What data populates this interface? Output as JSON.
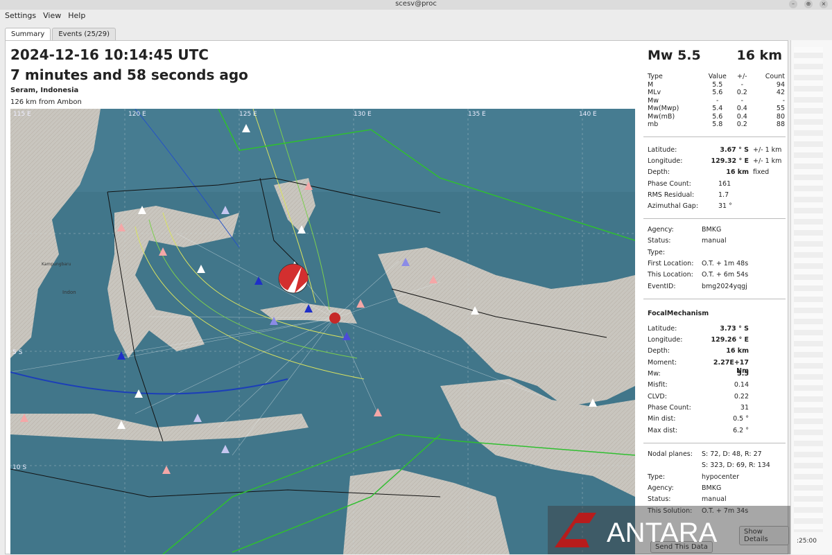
{
  "window": {
    "title": "scesv@proc",
    "buttons": [
      "–",
      "⊕",
      "×"
    ]
  },
  "menu": {
    "items": [
      "Settings",
      "View",
      "Help"
    ]
  },
  "tabs": [
    {
      "label": "Summary"
    },
    {
      "label": "Events (25/29)"
    }
  ],
  "event": {
    "time": "2024-12-16 10:14:45 UTC",
    "ago": "7 minutes and 58 seconds ago",
    "region": "Seram, Indonesia",
    "distance": "126 km from Ambon"
  },
  "summary": {
    "magnitude": "Mw 5.5",
    "depth": "16 km",
    "mag_headers": [
      "Type",
      "Value",
      "+/-",
      "Count"
    ],
    "mag_rows": [
      [
        "M",
        "5.5",
        "-",
        "94"
      ],
      [
        "MLv",
        "5.6",
        "0.2",
        "42"
      ],
      [
        "Mw",
        "-",
        "-",
        "-"
      ],
      [
        "Mw(Mwp)",
        "5.4",
        "0.4",
        "55"
      ],
      [
        "Mw(mB)",
        "5.6",
        "0.4",
        "80"
      ],
      [
        "mb",
        "5.8",
        "0.2",
        "88"
      ]
    ],
    "origin": {
      "latitude_label": "Latitude:",
      "latitude": "3.67 ° S",
      "latitude_unc": "+/-  1 km",
      "longitude_label": "Longitude:",
      "longitude": "129.32 ° E",
      "longitude_unc": "+/-  1 km",
      "depth_label": "Depth:",
      "depth": "16 km",
      "depth_note": "fixed",
      "phase_label": "Phase Count:",
      "phase": "161",
      "rms_label": "RMS Residual:",
      "rms": "1.7",
      "gap_label": "Azimuthal Gap:",
      "gap": "31 °"
    },
    "agency": {
      "agency_label": "Agency:",
      "agency": "BMKG",
      "status_label": "Status:",
      "status": "manual",
      "type_label": "Type:",
      "type": "",
      "first_label": "First Location:",
      "first": "O.T. + 1m 48s",
      "this_label": "This Location:",
      "this": "O.T. + 6m 54s",
      "eventid_label": "EventID:",
      "eventid": "bmg2024yqgj"
    },
    "focal": {
      "title": "FocalMechanism",
      "latitude_label": "Latitude:",
      "latitude": "3.73 ° S",
      "longitude_label": "Longitude:",
      "longitude": "129.26 ° E",
      "depth_label": "Depth:",
      "depth": "16 km",
      "moment_label": "Moment:",
      "moment": "2.27E+17 Nm",
      "mw_label": "Mw:",
      "mw": "5.5",
      "misfit_label": "Misfit:",
      "misfit": "0.14",
      "clvd_label": "CLVD:",
      "clvd": "0.22",
      "phase_label": "Phase Count:",
      "phase": "31",
      "mindist_label": "Min dist:",
      "mindist": "0.5 °",
      "maxdist_label": "Max dist:",
      "maxdist": "6.2 °",
      "nodal_label": "Nodal planes:",
      "nodal1": "S: 72, D: 48, R: 27",
      "nodal2": "S: 323, D: 69, R: 134",
      "type_label": "Type:",
      "type": "hypocenter",
      "agency_label": "Agency:",
      "agency": "BMKG",
      "status_label": "Status:",
      "status": "manual",
      "solution_label": "This Solution:",
      "solution": "O.T. + 7m 34s"
    },
    "buttons": {
      "details": "Show Details",
      "send": "Send This Data"
    }
  },
  "map": {
    "lon_labels": [
      "115 E",
      "120 E",
      "125 E",
      "130 E",
      "135 E",
      "140 E"
    ],
    "lat_labels": [
      "5 S",
      "10 S"
    ],
    "place_labels": [
      "Indon",
      "Kampungbaru"
    ]
  },
  "timeline": {
    "tick": ":25:00"
  },
  "watermark": {
    "text": "ANTARA"
  },
  "colors": {
    "epicenter": "#c62828",
    "station_blue": "#1f2fc8",
    "station_pink": "#f4a7a7",
    "plate_green": "#2fbf2f"
  }
}
